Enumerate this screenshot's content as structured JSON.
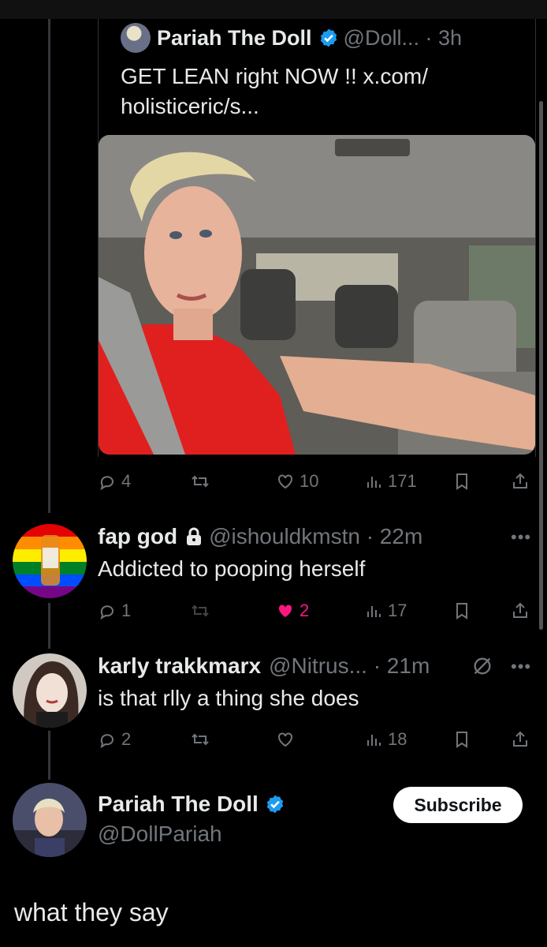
{
  "quoted_post": {
    "name": "Pariah The Doll",
    "handle_time": "@Doll... · 3h",
    "text_line1": "GET LEAN right NOW !! x.com/",
    "text_line2": "holisticeric/s...",
    "actions": {
      "replies": "4",
      "reposts": "",
      "likes": "10",
      "views": "171"
    }
  },
  "replies": [
    {
      "name": "fap god",
      "handle_time": "@ishouldkmstn · 22m",
      "text": "Addicted to pooping herself",
      "actions": {
        "replies": "1",
        "reposts": "",
        "likes": "2",
        "views": "17"
      },
      "liked": true
    },
    {
      "name": "karly trakkmarx",
      "handle_time": "@Nitrus... · 21m",
      "text": "is that rlly a thing she does",
      "actions": {
        "replies": "2",
        "reposts": "",
        "likes": "",
        "views": "18"
      },
      "liked": false
    }
  ],
  "profile_card": {
    "name": "Pariah The Doll",
    "handle": "@DollPariah",
    "subscribe_label": "Subscribe"
  },
  "caption": "what they say",
  "icons": {
    "reply": "reply-icon",
    "repost": "repost-icon",
    "like": "heart-icon",
    "views": "views-icon",
    "bookmark": "bookmark-icon",
    "share": "share-icon",
    "verified": "verified-badge-icon",
    "lock": "lock-icon",
    "more": "more-icon",
    "mute": "muted-icon"
  },
  "colors": {
    "background": "#000000",
    "text": "#e7e9ea",
    "muted": "#71767b",
    "like": "#f91880",
    "verified": "#1d9bf0"
  }
}
